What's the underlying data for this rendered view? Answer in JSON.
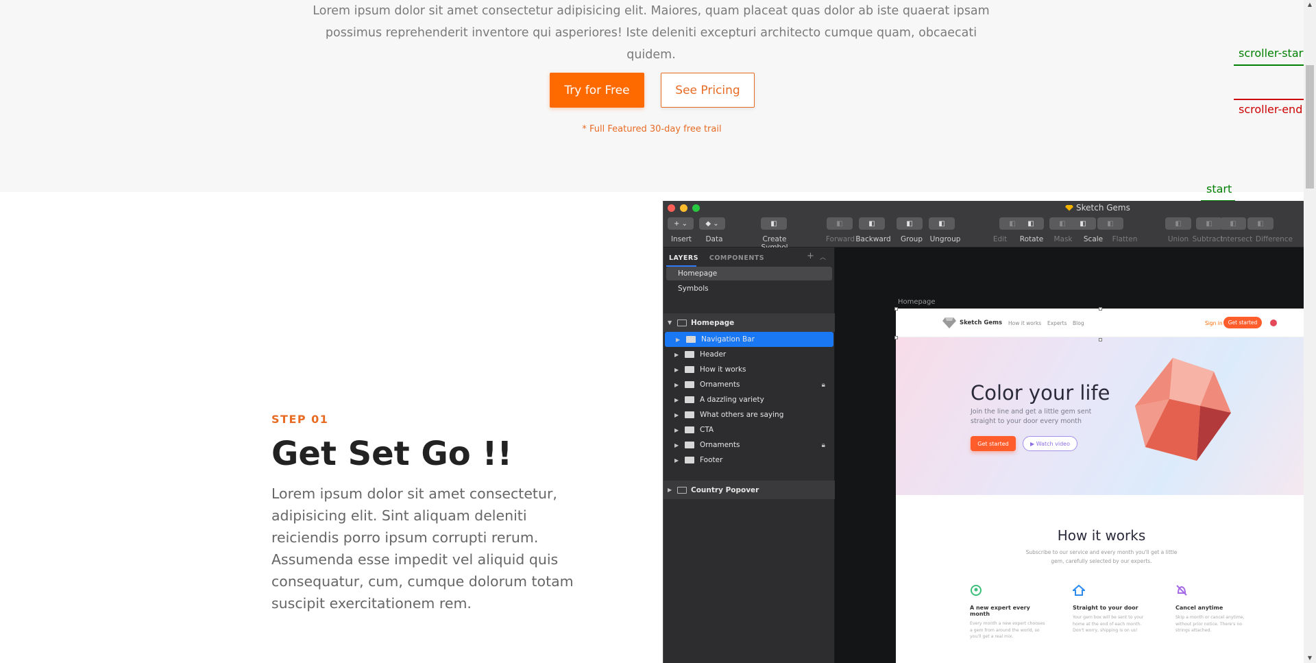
{
  "hero": {
    "description": "Lorem ipsum dolor sit amet consectetur adipisicing elit. Maiores, quam placeat quas dolor ab iste quaerat ipsam possimus reprehenderit inventore qui asperiores! Iste deleniti excepturi architecto cumque quam, obcaecati quidem.",
    "try_label": "Try for Free",
    "pricing_label": "See Pricing",
    "trial_note": "* Full Featured 30-day free trail"
  },
  "markers": {
    "scroller_start": "scroller-start",
    "scroller_end": "scroller-end",
    "start": "start",
    "colors": {
      "start": "#008000",
      "end": "#cc0000"
    }
  },
  "step": {
    "eyebrow": "STEP 01",
    "title": "Get Set Go !!",
    "text": "Lorem ipsum dolor sit amet consectetur, adipisicing elit. Sint aliquam deleniti reiciendis porro ipsum corrupti rerum. Assumenda esse impedit vel aliquid quis consequatur, cum, cumque dolorum totam suscipit exercitationem rem."
  },
  "app": {
    "title": "Sketch Gems",
    "toolbar": [
      {
        "label": "Insert",
        "icon": "plus-icon",
        "dim": false
      },
      {
        "label": "Data",
        "icon": "data-icon",
        "dim": false
      },
      {
        "label": "Create Symbol",
        "icon": "symbol-icon",
        "dim": false
      },
      {
        "label": "Forward",
        "icon": "forward-icon",
        "dim": true
      },
      {
        "label": "Backward",
        "icon": "backward-icon",
        "dim": false
      },
      {
        "label": "Group",
        "icon": "group-icon",
        "dim": false
      },
      {
        "label": "Ungroup",
        "icon": "ungroup-icon",
        "dim": false
      },
      {
        "label": "Edit",
        "icon": "edit-icon",
        "dim": true
      },
      {
        "label": "Rotate",
        "icon": "rotate-icon",
        "dim": false
      },
      {
        "label": "Mask",
        "icon": "mask-icon",
        "dim": true
      },
      {
        "label": "Scale",
        "icon": "scale-icon",
        "dim": false
      },
      {
        "label": "Flatten",
        "icon": "flatten-icon",
        "dim": true
      },
      {
        "label": "Union",
        "icon": "union-icon",
        "dim": true
      },
      {
        "label": "Subtract",
        "icon": "subtract-icon",
        "dim": true
      },
      {
        "label": "Intersect",
        "icon": "intersect-icon",
        "dim": true
      },
      {
        "label": "Difference",
        "icon": "difference-icon",
        "dim": true
      }
    ],
    "tabs": {
      "layers": "LAYERS",
      "components": "COMPONENTS"
    },
    "pages": [
      "Homepage",
      "Symbols"
    ],
    "artboard_group": "Homepage",
    "layers": [
      {
        "name": "Navigation Bar",
        "selected": true,
        "locked": false
      },
      {
        "name": "Header",
        "selected": false,
        "locked": false
      },
      {
        "name": "How it works",
        "selected": false,
        "locked": false
      },
      {
        "name": "Ornaments",
        "selected": false,
        "locked": true
      },
      {
        "name": "A dazzling variety",
        "selected": false,
        "locked": false
      },
      {
        "name": "What others are saying",
        "selected": false,
        "locked": false
      },
      {
        "name": "CTA",
        "selected": false,
        "locked": false
      },
      {
        "name": "Ornaments",
        "selected": false,
        "locked": true
      },
      {
        "name": "Footer",
        "selected": false,
        "locked": false
      }
    ],
    "second_group": "Country Popover",
    "canvas_label": "Homepage",
    "artboard": {
      "brand": "Sketch Gems",
      "nav_links": [
        "How it works",
        "Experts",
        "Blog"
      ],
      "sign_in": "Sign in",
      "get_started": "Get started",
      "hero_title": "Color your life",
      "hero_sub": "Join the line and get a little gem sent straight to your door every month",
      "hero_btn1": "Get started",
      "hero_btn2": "▶ Watch video",
      "hiw_title": "How it works",
      "hiw_sub": "Subscribe to our service and every month you'll get a little gem, carefully selected by our experts.",
      "features": [
        {
          "title": "A new expert every month",
          "text": "Every month a new expert chooses a gem from around the world, so you'll get a real mix."
        },
        {
          "title": "Straight to your door",
          "text": "Your gem box will be sent to your home at the end of each month. Don't worry, shipping is on us!"
        },
        {
          "title": "Cancel anytime",
          "text": "Skip a month or cancel anytime, without prior notice. There's no strings attached."
        }
      ]
    }
  }
}
